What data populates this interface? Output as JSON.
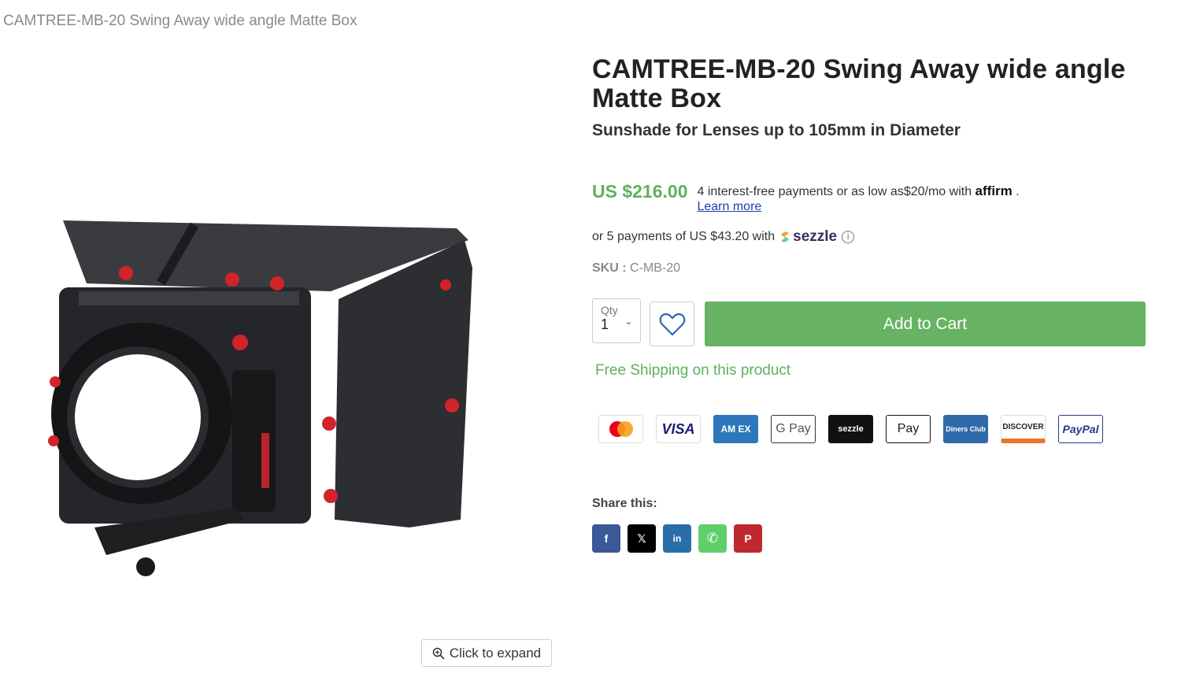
{
  "breadcrumb": {
    "text": "CAMTREE-MB-20 Swing Away wide angle Matte Box"
  },
  "product": {
    "title": "CAMTREE-MB-20 Swing Away wide angle Matte Box",
    "subtitle": "Sunshade for Lenses up to 105mm in Diameter",
    "price": "US $216.00",
    "affirm_text": "4 interest-free payments or as low as$20/mo with",
    "affirm_brand": "affirm",
    "affirm_period": ".",
    "learn_more": "Learn more",
    "sezzle_text": "or 5 payments of US $43.20 with",
    "sezzle_brand": "sezzle",
    "sku_label": "SKU :",
    "sku_value": "C-MB-20",
    "qty_label": "Qty",
    "qty_value": "1",
    "add_to_cart": "Add to Cart",
    "shipping": "Free Shipping on this product"
  },
  "gallery": {
    "expand_label": "Click to expand"
  },
  "payments": [
    {
      "name": "mastercard",
      "label": ""
    },
    {
      "name": "visa",
      "label": "VISA"
    },
    {
      "name": "amex",
      "label": "AM EX"
    },
    {
      "name": "google-pay",
      "label": "G Pay"
    },
    {
      "name": "sezzle",
      "label": "sezzle"
    },
    {
      "name": "apple-pay",
      "label": "Pay"
    },
    {
      "name": "diners-club",
      "label": "Diners Club"
    },
    {
      "name": "discover",
      "label": "DISCOVER"
    },
    {
      "name": "paypal",
      "label": "PayPal"
    }
  ],
  "share": {
    "label": "Share this:",
    "buttons": [
      {
        "name": "facebook",
        "glyph": "f",
        "color": "#3b5998"
      },
      {
        "name": "x",
        "glyph": "𝕏",
        "color": "#000000"
      },
      {
        "name": "linkedin",
        "glyph": "in",
        "color": "#2a6ea8"
      },
      {
        "name": "whatsapp",
        "glyph": "✆",
        "color": "#5fcf6c"
      },
      {
        "name": "pinterest",
        "glyph": "P",
        "color": "#c0282f"
      }
    ]
  },
  "colors": {
    "accent_green": "#68b363",
    "price_green": "#5fb05f"
  }
}
